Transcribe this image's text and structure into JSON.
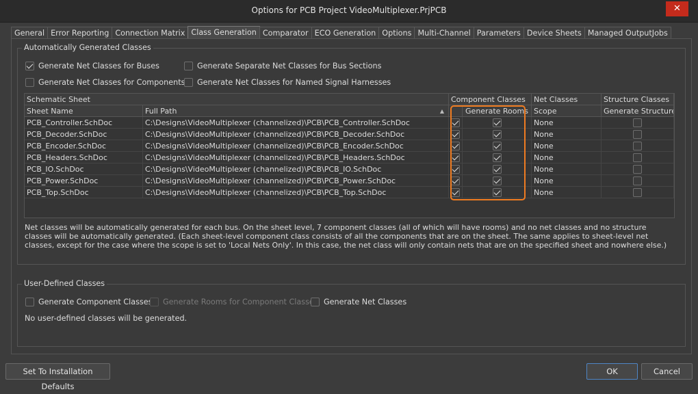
{
  "window": {
    "title": "Options for PCB Project VideoMultiplexer.PrjPCB",
    "close_icon": "✕"
  },
  "tabs": [
    {
      "label": "General",
      "active": false
    },
    {
      "label": "Error Reporting",
      "active": false
    },
    {
      "label": "Connection Matrix",
      "active": false
    },
    {
      "label": "Class Generation",
      "active": true
    },
    {
      "label": "Comparator",
      "active": false
    },
    {
      "label": "ECO Generation",
      "active": false
    },
    {
      "label": "Options",
      "active": false
    },
    {
      "label": "Multi-Channel",
      "active": false
    },
    {
      "label": "Parameters",
      "active": false
    },
    {
      "label": "Device Sheets",
      "active": false
    },
    {
      "label": "Managed OutputJobs",
      "active": false
    }
  ],
  "auto": {
    "title": "Automatically Generated Classes",
    "options": {
      "bus_net_classes": {
        "label": "Generate Net Classes for Buses",
        "checked": true
      },
      "bus_sections": {
        "label": "Generate Separate Net Classes for Bus Sections",
        "checked": false
      },
      "component_net_classes": {
        "label": "Generate Net Classes for Components",
        "checked": false
      },
      "harness_net_classes": {
        "label": "Generate Net Classes for Named Signal Harnesses",
        "checked": false
      }
    }
  },
  "grid": {
    "group_headers": {
      "schematic": "Schematic Sheet",
      "component": "Component Classes",
      "net": "Net Classes",
      "structure": "Structure Classes"
    },
    "columns": {
      "sheet_name": "Sheet Name",
      "full_path": "Full Path",
      "rooms": "Generate Rooms",
      "scope": "Scope",
      "gen_structure": "Generate Structure"
    },
    "rows": [
      {
        "sheet": "PCB_Controller.SchDoc",
        "path": "C:\\Designs\\VideoMultiplexer (channelized)\\PCB\\PCB_Controller.SchDoc",
        "comp": true,
        "rooms": true,
        "scope": "None",
        "structure": false
      },
      {
        "sheet": "PCB_Decoder.SchDoc",
        "path": "C:\\Designs\\VideoMultiplexer (channelized)\\PCB\\PCB_Decoder.SchDoc",
        "comp": true,
        "rooms": true,
        "scope": "None",
        "structure": false
      },
      {
        "sheet": "PCB_Encoder.SchDoc",
        "path": "C:\\Designs\\VideoMultiplexer (channelized)\\PCB\\PCB_Encoder.SchDoc",
        "comp": true,
        "rooms": true,
        "scope": "None",
        "structure": false
      },
      {
        "sheet": "PCB_Headers.SchDoc",
        "path": "C:\\Designs\\VideoMultiplexer (channelized)\\PCB\\PCB_Headers.SchDoc",
        "comp": true,
        "rooms": true,
        "scope": "None",
        "structure": false
      },
      {
        "sheet": "PCB_IO.SchDoc",
        "path": "C:\\Designs\\VideoMultiplexer (channelized)\\PCB\\PCB_IO.SchDoc",
        "comp": true,
        "rooms": true,
        "scope": "None",
        "structure": false
      },
      {
        "sheet": "PCB_Power.SchDoc",
        "path": "C:\\Designs\\VideoMultiplexer (channelized)\\PCB\\PCB_Power.SchDoc",
        "comp": true,
        "rooms": true,
        "scope": "None",
        "structure": false
      },
      {
        "sheet": "PCB_Top.SchDoc",
        "path": "C:\\Designs\\VideoMultiplexer (channelized)\\PCB\\PCB_Top.SchDoc",
        "comp": true,
        "rooms": true,
        "scope": "None",
        "structure": false
      }
    ]
  },
  "description": "Net classes will be automatically generated for each bus. On the sheet level, 7 component classes (all of which will have rooms) and no net classes and no structure classes will be automatically generated. (Each sheet-level component class consists of all the components that are on the sheet. The same applies to sheet-level net classes, except for the case where the scope is set to 'Local Nets Only'. In this case, the net class will only contain nets that are on the specified sheet and nowhere else.)",
  "user": {
    "title": "User-Defined Classes",
    "options": {
      "component_classes": {
        "label": "Generate Component Classes",
        "checked": false
      },
      "rooms": {
        "label": "Generate Rooms for Component Classes",
        "checked": false,
        "disabled": true
      },
      "net_classes": {
        "label": "Generate Net Classes",
        "checked": false
      }
    },
    "message": "No user-defined classes will be generated."
  },
  "buttons": {
    "defaults": "Set To Installation Defaults",
    "ok": "OK",
    "cancel": "Cancel"
  },
  "colors": {
    "highlight": "#f07c21",
    "background": "#3c3c3c"
  }
}
